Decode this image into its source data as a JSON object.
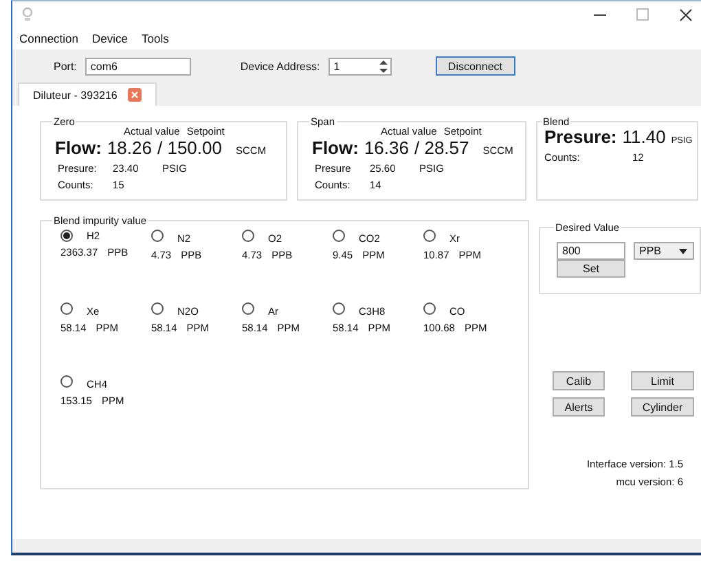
{
  "menu": [
    "Connection",
    "Device",
    "Tools"
  ],
  "toolbar": {
    "port_label": "Port:",
    "port_value": "com6",
    "address_label": "Device Address:",
    "address_value": "1",
    "button": "Disconnect"
  },
  "tabs": [
    {
      "label": "Diluteur - 393216",
      "selected": true
    }
  ],
  "flow_panels": [
    {
      "title": "Zero",
      "actual_label": "Actual value",
      "setpoint_label": "Setpoint",
      "flow_label": "Flow:",
      "actual": "18.26",
      "setpoint": "/ 150.00",
      "unit": "SCCM",
      "pressure_label": "Presure:",
      "pressure": "23.40",
      "pressure_unit": "PSIG",
      "counts_label": "Counts:",
      "counts": "15"
    },
    {
      "title": "Span",
      "actual_label": "Actual value",
      "setpoint_label": "Setpoint",
      "flow_label": "Flow:",
      "actual": "16.36",
      "setpoint": "/ 28.57",
      "unit": "SCCM",
      "pressure_label": "Presure",
      "pressure": "25.60",
      "pressure_unit": "PSIG",
      "counts_label": "Counts:",
      "counts": "14"
    }
  ],
  "blend": {
    "title": "Blend",
    "pressure_label": "Presure:",
    "pressure": "11.40",
    "unit": "PSIG",
    "counts_label": "Counts:",
    "counts": "12"
  },
  "impurities": {
    "title": "Blend impurity value",
    "items": [
      {
        "name": "H2",
        "value": "2363.37",
        "unit": "PPB",
        "selected": true
      },
      {
        "name": "N2",
        "value": "4.73",
        "unit": "PPB",
        "selected": false
      },
      {
        "name": "O2",
        "value": "4.73",
        "unit": "PPB",
        "selected": false
      },
      {
        "name": "CO2",
        "value": "9.45",
        "unit": "PPM",
        "selected": false
      },
      {
        "name": "Xr",
        "value": "10.87",
        "unit": "PPM",
        "selected": false
      },
      {
        "name": "Xe",
        "value": "58.14",
        "unit": "PPM",
        "selected": false
      },
      {
        "name": "N2O",
        "value": "58.14",
        "unit": "PPM",
        "selected": false
      },
      {
        "name": "Ar",
        "value": "58.14",
        "unit": "PPM",
        "selected": false
      },
      {
        "name": "C3H8",
        "value": "58.14",
        "unit": "PPM",
        "selected": false
      },
      {
        "name": "CO",
        "value": "100.68",
        "unit": "PPM",
        "selected": false
      },
      {
        "name": "CH4",
        "value": "153.15",
        "unit": "PPM",
        "selected": false
      }
    ]
  },
  "desired": {
    "title": "Desired Value",
    "value": "800",
    "unit": "PPB",
    "button": "Set"
  },
  "buttons": [
    "Calib",
    "Limit",
    "Alerts",
    "Cylinder"
  ],
  "versions": [
    "Interface version: 1.5",
    "mcu version: 6"
  ]
}
